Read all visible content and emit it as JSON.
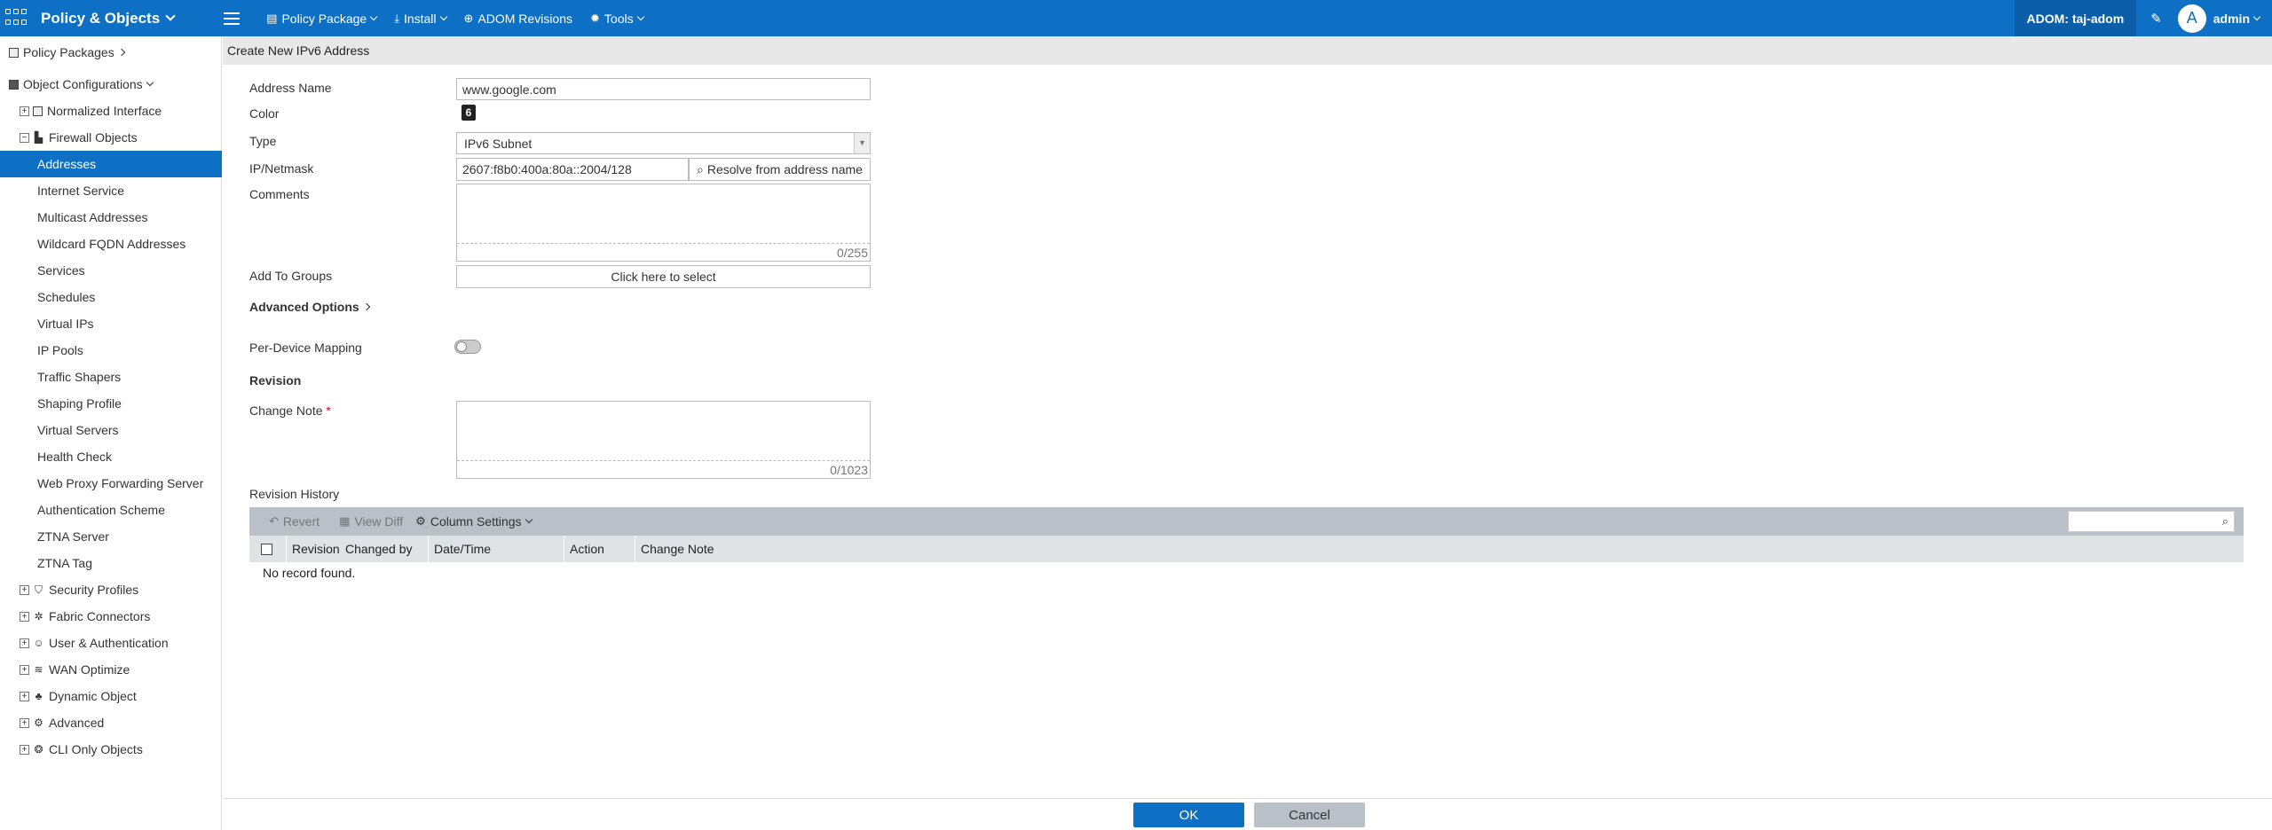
{
  "topbar": {
    "app_title": "Policy & Objects",
    "menus": [
      {
        "label": "Policy Package",
        "icon": "policy-package-icon"
      },
      {
        "label": "Install",
        "icon": "install-icon"
      },
      {
        "label": "ADOM Revisions",
        "icon": "globe-icon"
      },
      {
        "label": "Tools",
        "icon": "tools-icon"
      }
    ],
    "adom": "ADOM: taj-adom",
    "avatar_letter": "A",
    "user": "admin"
  },
  "sidebar": {
    "policy_packages": "Policy Packages",
    "object_configurations": "Object Configurations",
    "normalized_interface": "Normalized Interface",
    "firewall_objects": "Firewall Objects",
    "firewall_children": [
      "Addresses",
      "Internet Service",
      "Multicast Addresses",
      "Wildcard FQDN Addresses",
      "Services",
      "Schedules",
      "Virtual IPs",
      "IP Pools",
      "Traffic Shapers",
      "Shaping Profile",
      "Virtual Servers",
      "Health Check",
      "Web Proxy Forwarding Server",
      "Authentication Scheme",
      "ZTNA Server",
      "ZTNA Tag"
    ],
    "groups": [
      "Security Profiles",
      "Fabric Connectors",
      "User & Authentication",
      "WAN Optimize",
      "Dynamic Object",
      "Advanced",
      "CLI Only Objects"
    ],
    "selected": "Addresses"
  },
  "form": {
    "header": "Create New IPv6 Address",
    "address_name_label": "Address Name",
    "address_name_value": "www.google.com",
    "color_label": "Color",
    "color_value": "6",
    "type_label": "Type",
    "type_value": "IPv6 Subnet",
    "ip_label": "IP/Netmask",
    "ip_value": "2607:f8b0:400a:80a::2004/128",
    "resolve_label": "Resolve from address name",
    "comments_label": "Comments",
    "comments_count": "0/255",
    "groups_label": "Add To Groups",
    "groups_placeholder": "Click here to select",
    "advanced_label": "Advanced Options",
    "per_device_label": "Per-Device Mapping",
    "revision_label": "Revision",
    "change_note_label": "Change Note",
    "change_note_required": "*",
    "change_note_count": "0/1023",
    "history_label": "Revision History"
  },
  "history": {
    "toolbar": {
      "revert": "Revert",
      "view_diff": "View Diff",
      "column_settings": "Column Settings"
    },
    "columns": [
      "Revision",
      "Changed by",
      "Date/Time",
      "Action",
      "Change Note"
    ],
    "empty": "No record found."
  },
  "footer": {
    "ok": "OK",
    "cancel": "Cancel"
  }
}
